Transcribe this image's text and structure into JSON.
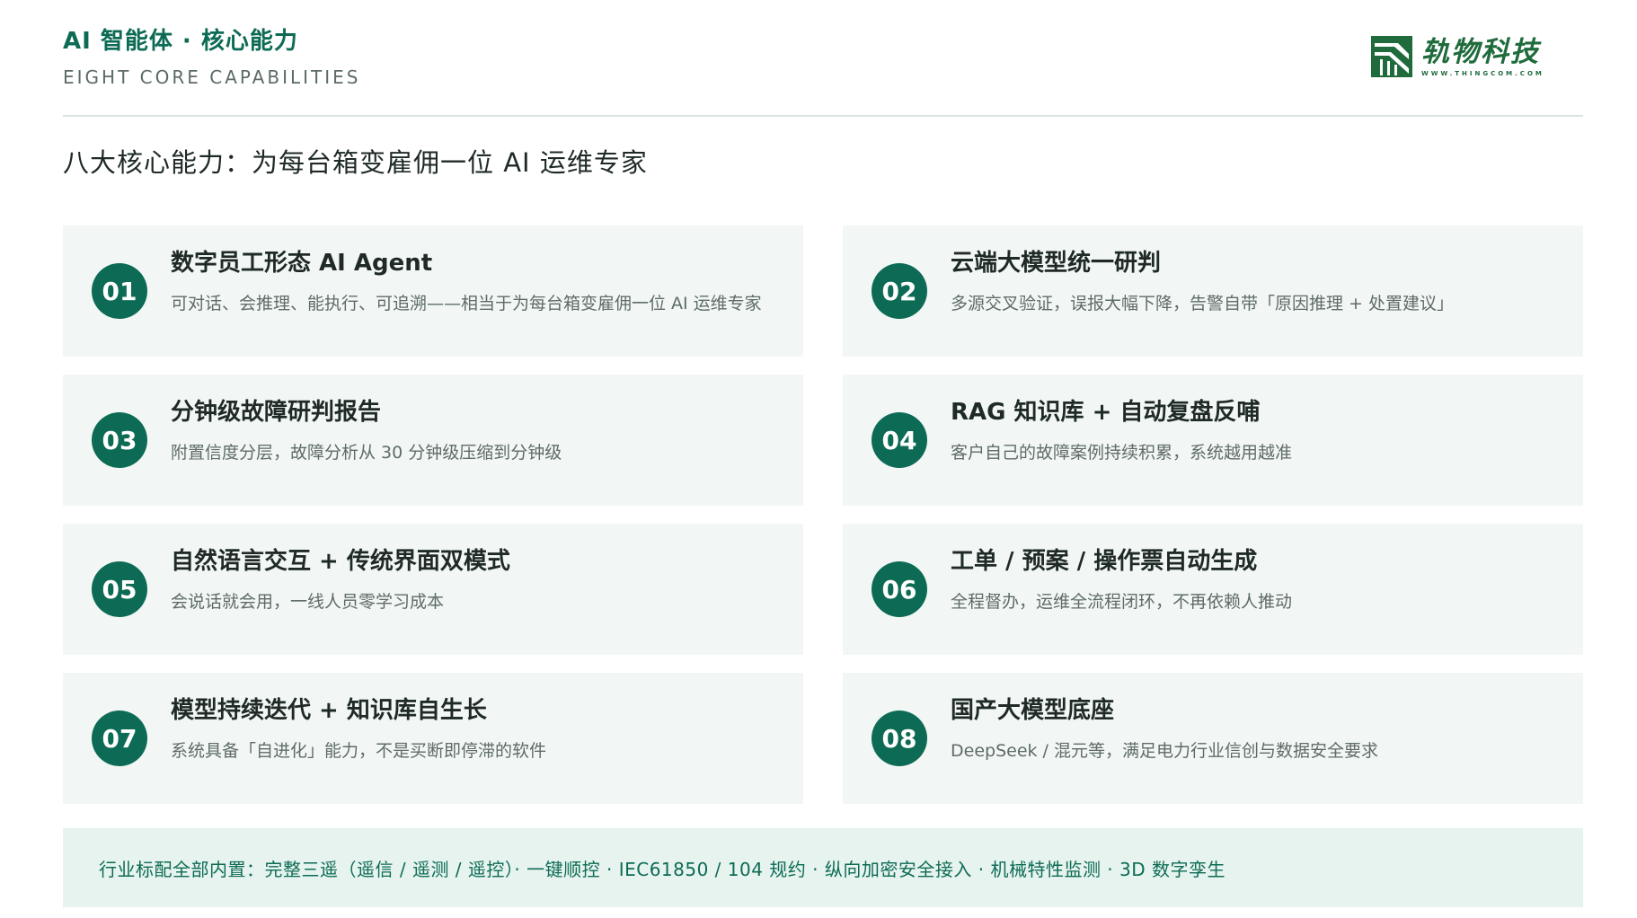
{
  "header": {
    "title": "AI 智能体 · 核心能力",
    "subtitle": "EIGHT CORE CAPABILITIES"
  },
  "logo": {
    "name": "轨物科技",
    "url": "WWW.THINGCOM.COM",
    "icon": "thingcom-logo-mark",
    "color": "#1f6b3c"
  },
  "heading": "八大核心能力：为每台箱变雇佣一位 AI 运维专家",
  "colors": {
    "accent": "#0d6b55",
    "card_bg": "#f2f7f5",
    "footer_bg": "#e6f3ee"
  },
  "cards": [
    {
      "num": "01",
      "title": "数字员工形态 AI Agent",
      "desc": "可对话、会推理、能执行、可追溯——相当于为每台箱变雇佣一位 AI 运维专家"
    },
    {
      "num": "02",
      "title": "云端大模型统一研判",
      "desc": "多源交叉验证，误报大幅下降，告警自带「原因推理 + 处置建议」"
    },
    {
      "num": "03",
      "title": "分钟级故障研判报告",
      "desc": "附置信度分层，故障分析从 30 分钟级压缩到分钟级"
    },
    {
      "num": "04",
      "title": "RAG 知识库 + 自动复盘反哺",
      "desc": "客户自己的故障案例持续积累，系统越用越准"
    },
    {
      "num": "05",
      "title": "自然语言交互 + 传统界面双模式",
      "desc": "会说话就会用，一线人员零学习成本"
    },
    {
      "num": "06",
      "title": "工单 / 预案 / 操作票自动生成",
      "desc": "全程督办，运维全流程闭环，不再依赖人推动"
    },
    {
      "num": "07",
      "title": "模型持续迭代 + 知识库自生长",
      "desc": "系统具备「自进化」能力，不是买断即停滞的软件"
    },
    {
      "num": "08",
      "title": "国产大模型底座",
      "desc": "DeepSeek / 混元等，满足电力行业信创与数据安全要求"
    }
  ],
  "footer": "行业标配全部内置：完整三遥（遥信 / 遥测 / 遥控）· 一键顺控 · IEC61850 / 104 规约 · 纵向加密安全接入 · 机械特性监测 · 3D 数字孪生"
}
